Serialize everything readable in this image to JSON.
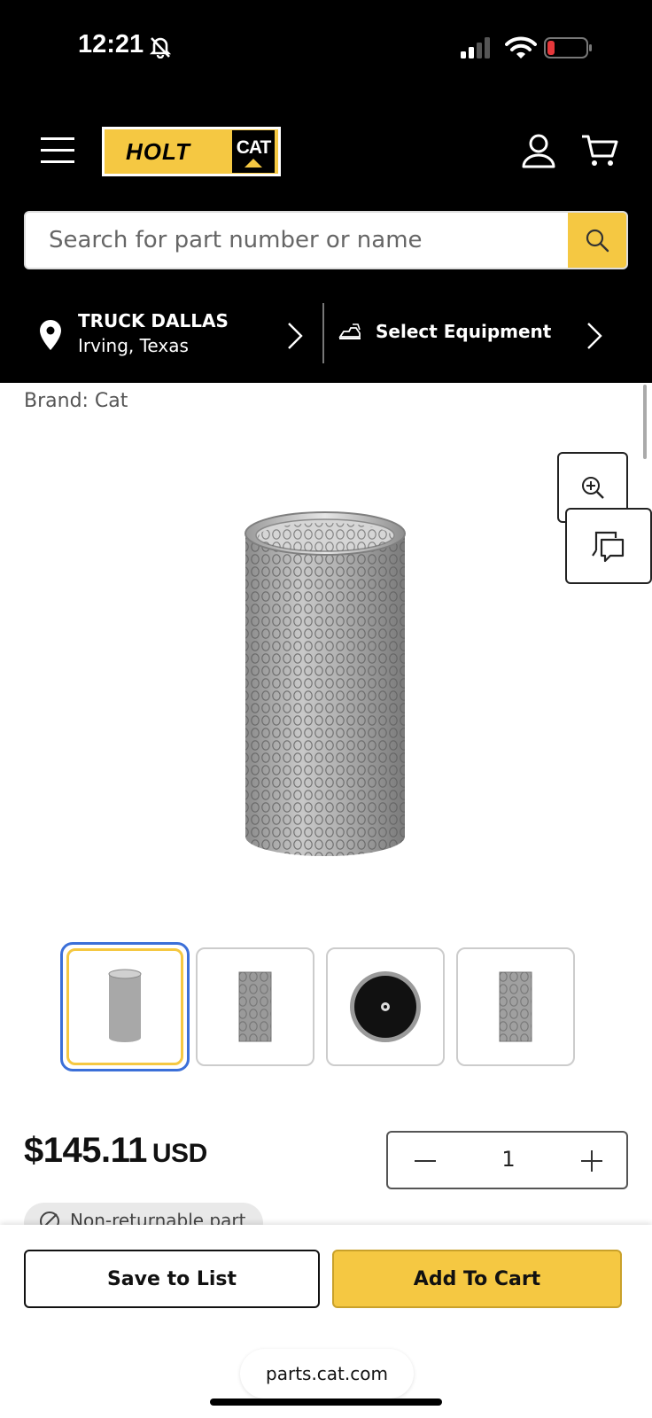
{
  "status_bar": {
    "time": "12:21"
  },
  "header": {
    "logo_left": "HOLT",
    "logo_right": "CAT",
    "search": {
      "placeholder": "Search for part number or name"
    },
    "store": {
      "name": "TRUCK DALLAS",
      "city": "Irving, Texas"
    },
    "equipment_label": "Select Equipment"
  },
  "product": {
    "brand": "Brand: Cat",
    "price": "$145.11",
    "currency": "USD",
    "quantity": "1",
    "return_policy": "Non-returnable part",
    "thumbnails": [
      "side-view",
      "front-view",
      "top-view",
      "back-view"
    ],
    "selected_thumbnail": 0
  },
  "actions": {
    "save_label": "Save to List",
    "add_label": "Add To Cart"
  },
  "browser": {
    "url": "parts.cat.com"
  },
  "colors": {
    "accent": "#f5c842",
    "header_bg": "#000000",
    "selected_outline": "#3b6fd8"
  }
}
